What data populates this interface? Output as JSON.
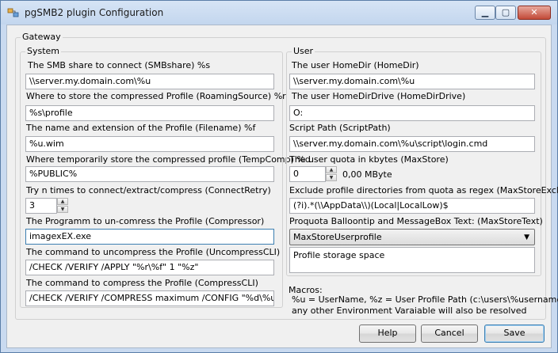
{
  "window": {
    "title": "pgSMB2 plugin Configuration",
    "icon": "plugin-app-icon",
    "controls": {
      "minimize": "▁",
      "maximize": "▢",
      "close": "✕"
    }
  },
  "gateway": {
    "legend": "Gateway",
    "system": {
      "legend": "System",
      "fields": [
        {
          "label": "The SMB share to connect (SMBshare) %s",
          "value": "\\\\server.my.domain.com\\%u"
        },
        {
          "label": "Where to store the compressed Profile (RoamingSource) %r",
          "value": "%s\\profile"
        },
        {
          "label": "The name and extension of the Profile (Filename) %f",
          "value": "%u.wim"
        },
        {
          "label": "Where temporarily store the compressed profile (TempComp) %d",
          "value": "%PUBLIC%"
        },
        {
          "label": "Try n times to connect/extract/compress (ConnectRetry)",
          "value": "3"
        },
        {
          "label": "The Programm to un-comress the Profile (Compressor)",
          "value": "imagexEX.exe"
        },
        {
          "label": "The command to uncompress the Profile (UncompressCLI)",
          "value": "/CHECK /VERIFY /APPLY \"%r\\%f\" 1 \"%z\""
        },
        {
          "label": "The command to compress the Profile (CompressCLI)",
          "value": "/CHECK /VERIFY /COMPRESS maximum /CONFIG \"%d\\%u.ini\""
        }
      ]
    },
    "user": {
      "legend": "User",
      "fields": [
        {
          "label": "The user HomeDir (HomeDir)",
          "value": "\\\\server.my.domain.com\\%u"
        },
        {
          "label": "The user HomeDirDrive (HomeDirDrive)",
          "value": "O:"
        },
        {
          "label": "Script Path (ScriptPath)",
          "value": "\\\\server.my.domain.com\\%u\\script\\login.cmd"
        },
        {
          "label": "The user quota in kbytes (MaxStore)",
          "value": "0",
          "suffix": "0,00 MByte"
        },
        {
          "label": "Exclude profile directories from quota as regex (MaxStoreExclude)",
          "value": "(?i).*(\\\\AppData\\\\)(Local|LocalLow)$"
        },
        {
          "label": "Proquota Balloontip and MessageBox Text: (MaxStoreText)",
          "value": "MaxStoreUserprofile"
        }
      ],
      "text_area": "Profile storage space"
    },
    "macros": {
      "title": "Macros:",
      "line1": "%u = UserName, %z = User Profile Path (c:\\users\\%username%)",
      "line2": "any other Environment Varaiable will also be resolved"
    }
  },
  "buttons": {
    "help": "Help",
    "cancel": "Cancel",
    "save": "Save"
  }
}
